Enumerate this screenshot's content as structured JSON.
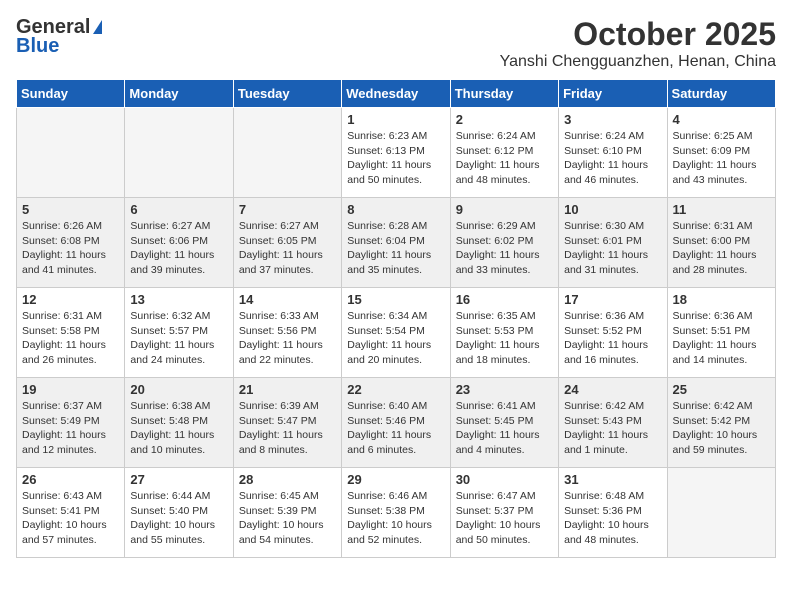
{
  "header": {
    "logo_general": "General",
    "logo_blue": "Blue",
    "month": "October 2025",
    "location": "Yanshi Chengguanzhen, Henan, China"
  },
  "weekdays": [
    "Sunday",
    "Monday",
    "Tuesday",
    "Wednesday",
    "Thursday",
    "Friday",
    "Saturday"
  ],
  "weeks": [
    [
      {
        "day": "",
        "info": ""
      },
      {
        "day": "",
        "info": ""
      },
      {
        "day": "",
        "info": ""
      },
      {
        "day": "1",
        "info": "Sunrise: 6:23 AM\nSunset: 6:13 PM\nDaylight: 11 hours\nand 50 minutes."
      },
      {
        "day": "2",
        "info": "Sunrise: 6:24 AM\nSunset: 6:12 PM\nDaylight: 11 hours\nand 48 minutes."
      },
      {
        "day": "3",
        "info": "Sunrise: 6:24 AM\nSunset: 6:10 PM\nDaylight: 11 hours\nand 46 minutes."
      },
      {
        "day": "4",
        "info": "Sunrise: 6:25 AM\nSunset: 6:09 PM\nDaylight: 11 hours\nand 43 minutes."
      }
    ],
    [
      {
        "day": "5",
        "info": "Sunrise: 6:26 AM\nSunset: 6:08 PM\nDaylight: 11 hours\nand 41 minutes."
      },
      {
        "day": "6",
        "info": "Sunrise: 6:27 AM\nSunset: 6:06 PM\nDaylight: 11 hours\nand 39 minutes."
      },
      {
        "day": "7",
        "info": "Sunrise: 6:27 AM\nSunset: 6:05 PM\nDaylight: 11 hours\nand 37 minutes."
      },
      {
        "day": "8",
        "info": "Sunrise: 6:28 AM\nSunset: 6:04 PM\nDaylight: 11 hours\nand 35 minutes."
      },
      {
        "day": "9",
        "info": "Sunrise: 6:29 AM\nSunset: 6:02 PM\nDaylight: 11 hours\nand 33 minutes."
      },
      {
        "day": "10",
        "info": "Sunrise: 6:30 AM\nSunset: 6:01 PM\nDaylight: 11 hours\nand 31 minutes."
      },
      {
        "day": "11",
        "info": "Sunrise: 6:31 AM\nSunset: 6:00 PM\nDaylight: 11 hours\nand 28 minutes."
      }
    ],
    [
      {
        "day": "12",
        "info": "Sunrise: 6:31 AM\nSunset: 5:58 PM\nDaylight: 11 hours\nand 26 minutes."
      },
      {
        "day": "13",
        "info": "Sunrise: 6:32 AM\nSunset: 5:57 PM\nDaylight: 11 hours\nand 24 minutes."
      },
      {
        "day": "14",
        "info": "Sunrise: 6:33 AM\nSunset: 5:56 PM\nDaylight: 11 hours\nand 22 minutes."
      },
      {
        "day": "15",
        "info": "Sunrise: 6:34 AM\nSunset: 5:54 PM\nDaylight: 11 hours\nand 20 minutes."
      },
      {
        "day": "16",
        "info": "Sunrise: 6:35 AM\nSunset: 5:53 PM\nDaylight: 11 hours\nand 18 minutes."
      },
      {
        "day": "17",
        "info": "Sunrise: 6:36 AM\nSunset: 5:52 PM\nDaylight: 11 hours\nand 16 minutes."
      },
      {
        "day": "18",
        "info": "Sunrise: 6:36 AM\nSunset: 5:51 PM\nDaylight: 11 hours\nand 14 minutes."
      }
    ],
    [
      {
        "day": "19",
        "info": "Sunrise: 6:37 AM\nSunset: 5:49 PM\nDaylight: 11 hours\nand 12 minutes."
      },
      {
        "day": "20",
        "info": "Sunrise: 6:38 AM\nSunset: 5:48 PM\nDaylight: 11 hours\nand 10 minutes."
      },
      {
        "day": "21",
        "info": "Sunrise: 6:39 AM\nSunset: 5:47 PM\nDaylight: 11 hours\nand 8 minutes."
      },
      {
        "day": "22",
        "info": "Sunrise: 6:40 AM\nSunset: 5:46 PM\nDaylight: 11 hours\nand 6 minutes."
      },
      {
        "day": "23",
        "info": "Sunrise: 6:41 AM\nSunset: 5:45 PM\nDaylight: 11 hours\nand 4 minutes."
      },
      {
        "day": "24",
        "info": "Sunrise: 6:42 AM\nSunset: 5:43 PM\nDaylight: 11 hours\nand 1 minute."
      },
      {
        "day": "25",
        "info": "Sunrise: 6:42 AM\nSunset: 5:42 PM\nDaylight: 10 hours\nand 59 minutes."
      }
    ],
    [
      {
        "day": "26",
        "info": "Sunrise: 6:43 AM\nSunset: 5:41 PM\nDaylight: 10 hours\nand 57 minutes."
      },
      {
        "day": "27",
        "info": "Sunrise: 6:44 AM\nSunset: 5:40 PM\nDaylight: 10 hours\nand 55 minutes."
      },
      {
        "day": "28",
        "info": "Sunrise: 6:45 AM\nSunset: 5:39 PM\nDaylight: 10 hours\nand 54 minutes."
      },
      {
        "day": "29",
        "info": "Sunrise: 6:46 AM\nSunset: 5:38 PM\nDaylight: 10 hours\nand 52 minutes."
      },
      {
        "day": "30",
        "info": "Sunrise: 6:47 AM\nSunset: 5:37 PM\nDaylight: 10 hours\nand 50 minutes."
      },
      {
        "day": "31",
        "info": "Sunrise: 6:48 AM\nSunset: 5:36 PM\nDaylight: 10 hours\nand 48 minutes."
      },
      {
        "day": "",
        "info": ""
      }
    ]
  ]
}
